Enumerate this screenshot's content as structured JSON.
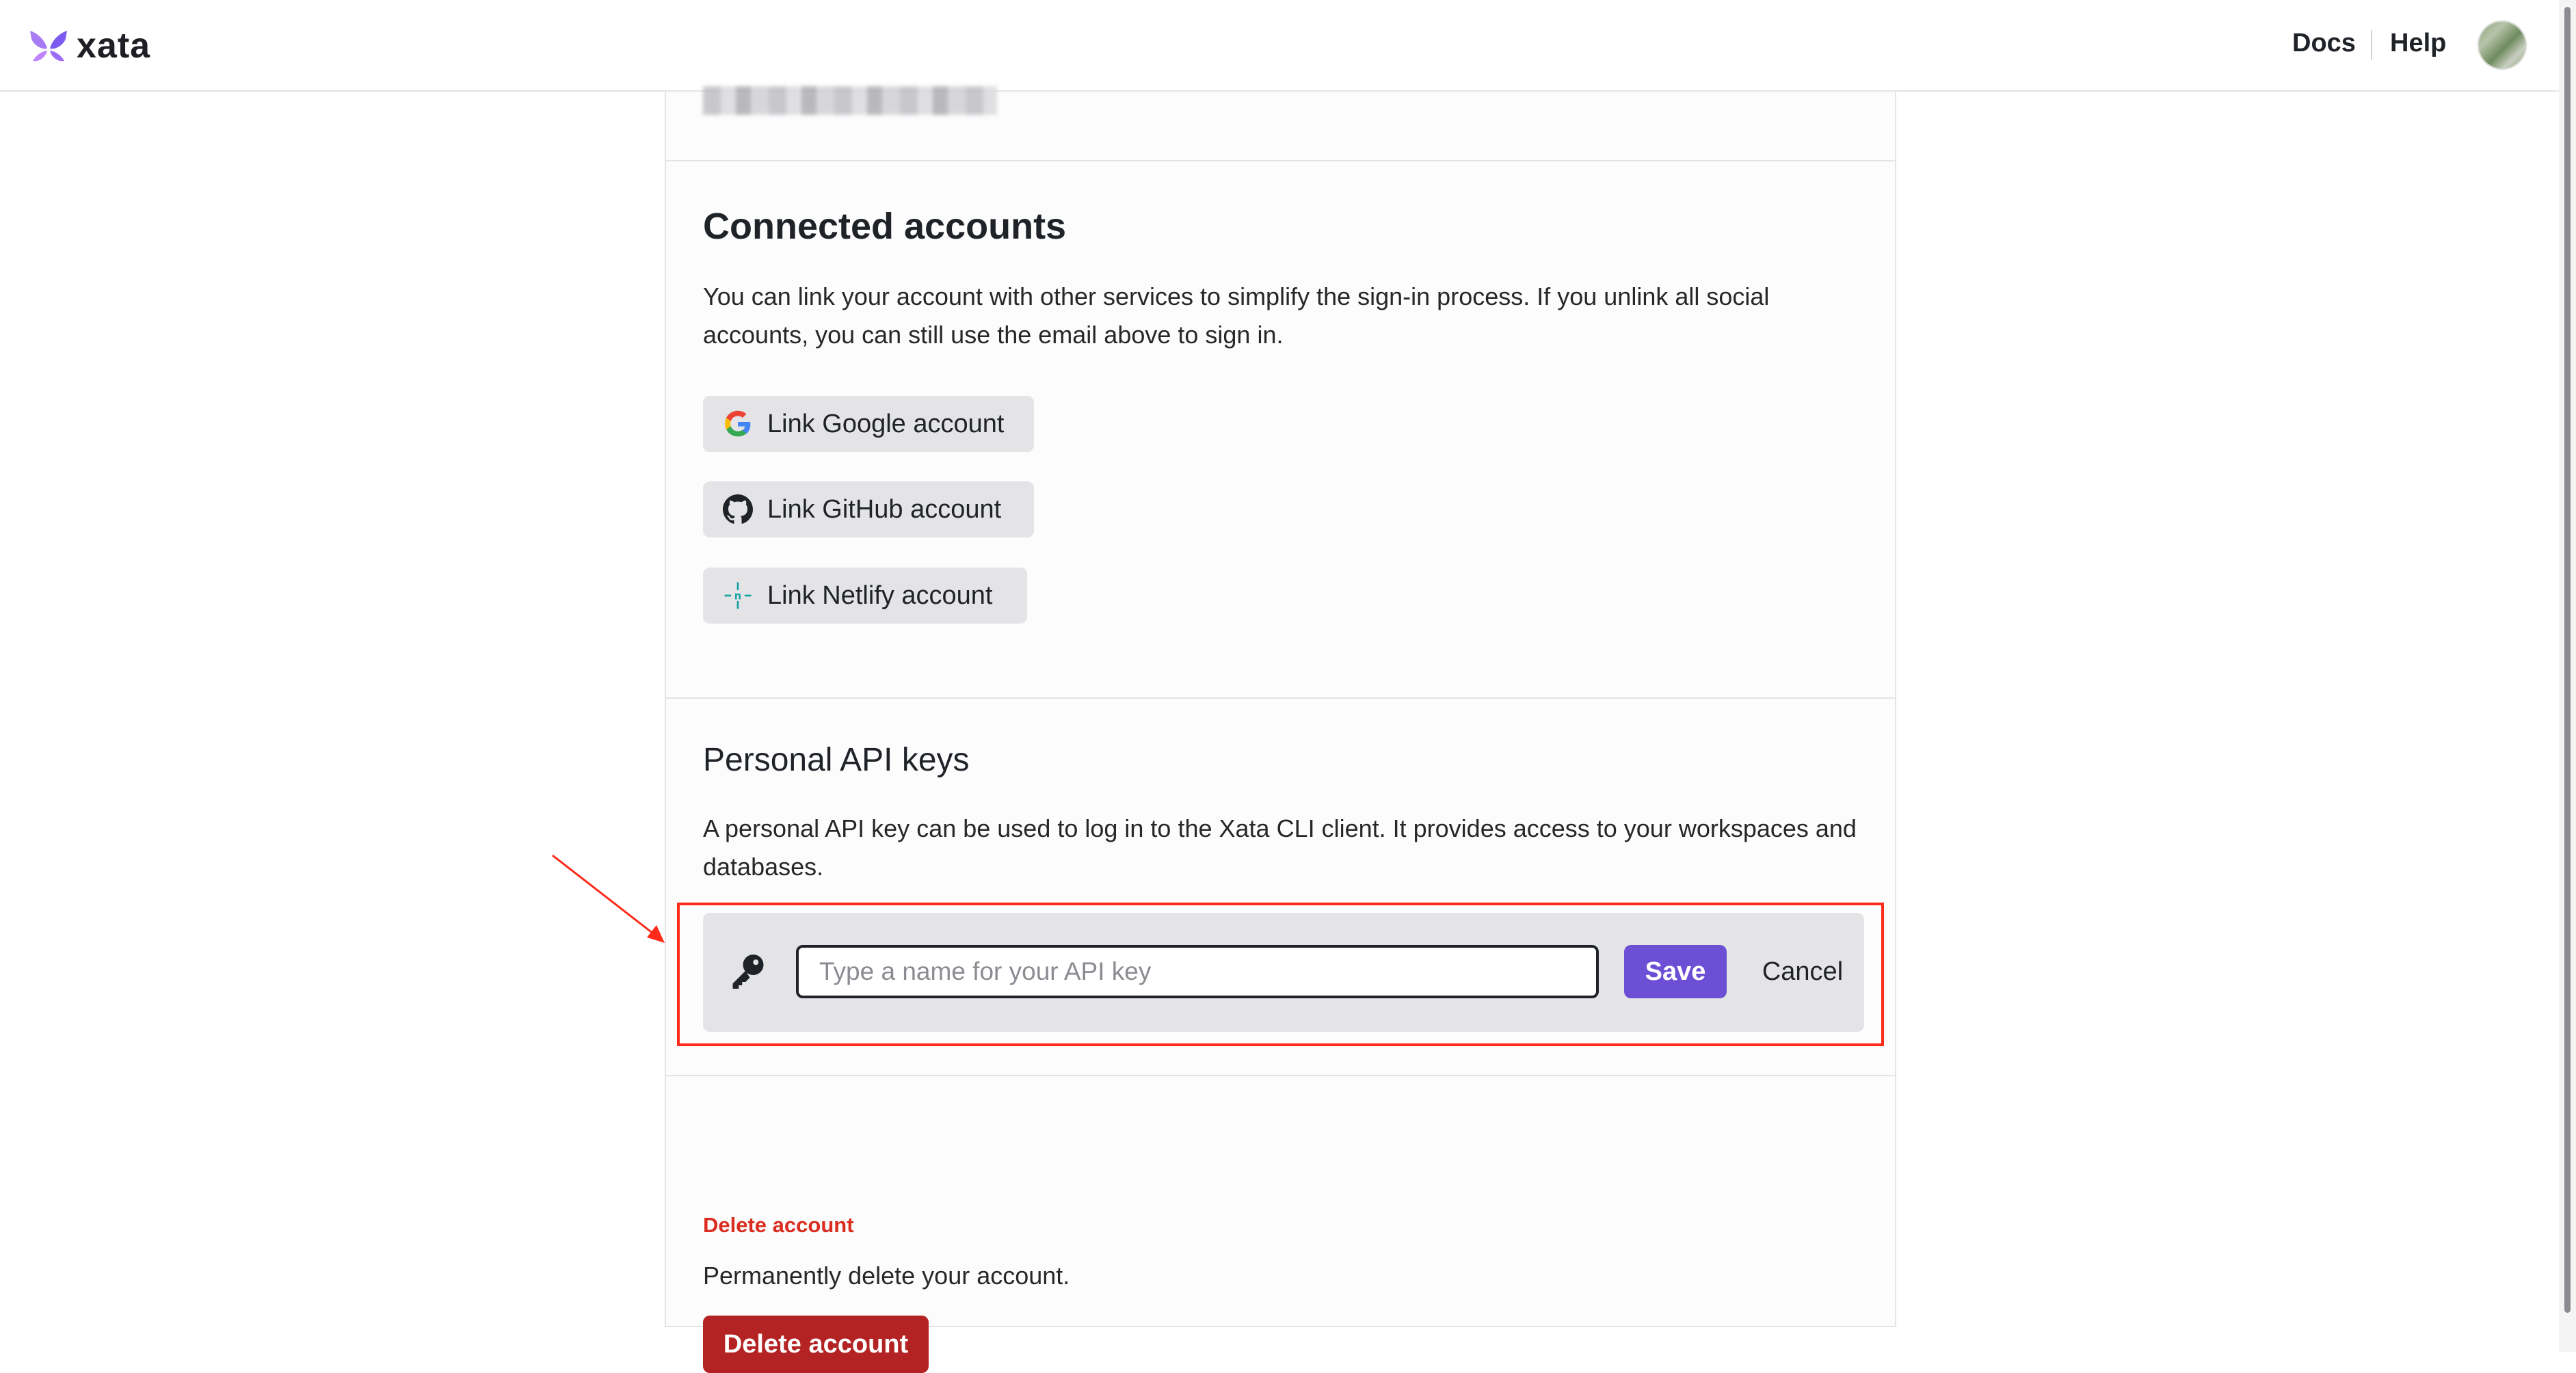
{
  "header": {
    "logo_text": "xata",
    "nav": {
      "docs": "Docs",
      "help": "Help"
    }
  },
  "connected_accounts": {
    "title": "Connected accounts",
    "description": "You can link your account with other services to simplify the sign-in process. If you unlink all social accounts, you can still use the email above to sign in.",
    "buttons": [
      {
        "label": "Link Google account",
        "icon": "google-icon"
      },
      {
        "label": "Link GitHub account",
        "icon": "github-icon"
      },
      {
        "label": "Link Netlify account",
        "icon": "netlify-icon"
      }
    ]
  },
  "api_keys": {
    "title": "Personal API keys",
    "description": "A personal API key can be used to log in to the Xata CLI client. It provides access to your workspaces and databases.",
    "input_placeholder": "Type a name for your API key",
    "input_value": "",
    "save_label": "Save",
    "cancel_label": "Cancel"
  },
  "delete_account": {
    "section_label": "Delete account",
    "description": "Permanently delete your account.",
    "button_label": "Delete account"
  },
  "colors": {
    "accent": "#6d4fd6",
    "danger": "#b42323",
    "annotation": "#ff2a1a"
  }
}
